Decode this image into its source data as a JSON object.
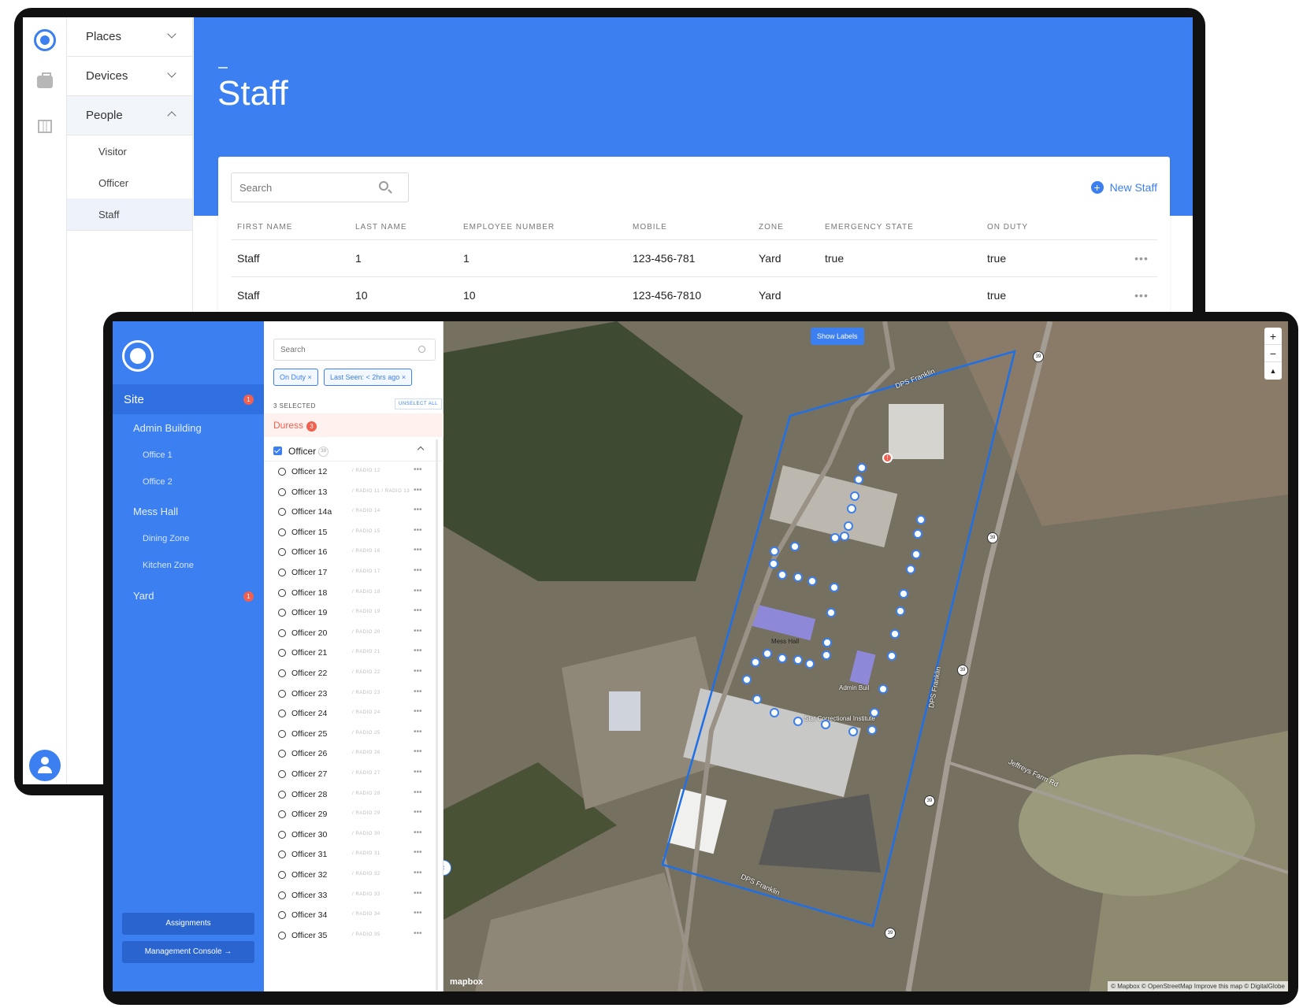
{
  "admin": {
    "nav": [
      {
        "label": "Places",
        "expanded": false
      },
      {
        "label": "Devices",
        "expanded": false
      },
      {
        "label": "People",
        "expanded": true,
        "children": [
          "Visitor",
          "Officer",
          "Staff"
        ],
        "selected": "Staff"
      }
    ],
    "page_title": "Staff",
    "search_placeholder": "Search",
    "new_button": "New Staff",
    "columns": [
      "FIRST NAME",
      "LAST NAME",
      "EMPLOYEE NUMBER",
      "MOBILE",
      "ZONE",
      "EMERGENCY STATE",
      "ON DUTY"
    ],
    "rows": [
      [
        "Staff",
        "1",
        "1",
        "123-456-781",
        "Yard",
        "true",
        "true"
      ],
      [
        "Staff",
        "10",
        "10",
        "123-456-7810",
        "Yard",
        "",
        "true"
      ]
    ],
    "row_menu": "•••"
  },
  "console": {
    "site_label": "Site",
    "site_badge": "1",
    "zones": [
      {
        "label": "Admin Building",
        "level": 1
      },
      {
        "label": "Office 1",
        "level": 2
      },
      {
        "label": "Office 2",
        "level": 2
      },
      {
        "label": "Mess Hall",
        "level": 1
      },
      {
        "label": "Dining Zone",
        "level": 2
      },
      {
        "label": "Kitchen Zone",
        "level": 2
      },
      {
        "label": "Yard",
        "level": 1,
        "badge": "1"
      }
    ],
    "buttons": {
      "assignments": "Assignments",
      "management": "Management Console →"
    },
    "search_placeholder": "Search",
    "filters": [
      "On Duty ×",
      "Last Seen: < 2hrs ago ×"
    ],
    "selected_count": "3 SELECTED",
    "unselect_all": "UNSELECT ALL",
    "duress_label": "Duress",
    "duress_count": "3",
    "group_label": "Officer",
    "group_count": "39",
    "officers": [
      {
        "name": "Officer 12",
        "radio": "/ RADIO 12"
      },
      {
        "name": "Officer 13",
        "radio": "/ RADIO 11 / RADIO 13"
      },
      {
        "name": "Officer 14a",
        "radio": "/ RADIO 14"
      },
      {
        "name": "Officer 15",
        "radio": "/ RADIO 15"
      },
      {
        "name": "Officer 16",
        "radio": "/ RADIO 16"
      },
      {
        "name": "Officer 17",
        "radio": "/ RADIO 17"
      },
      {
        "name": "Officer 18",
        "radio": "/ RADIO 18"
      },
      {
        "name": "Officer 19",
        "radio": "/ RADIO 19"
      },
      {
        "name": "Officer 20",
        "radio": "/ RADIO 20"
      },
      {
        "name": "Officer 21",
        "radio": "/ RADIO 21"
      },
      {
        "name": "Officer 22",
        "radio": "/ RADIO 22"
      },
      {
        "name": "Officer 23",
        "radio": "/ RADIO 23"
      },
      {
        "name": "Officer 24",
        "radio": "/ RADIO 24"
      },
      {
        "name": "Officer 25",
        "radio": "/ RADIO 25"
      },
      {
        "name": "Officer 26",
        "radio": "/ RADIO 26"
      },
      {
        "name": "Officer 27",
        "radio": "/ RADIO 27"
      },
      {
        "name": "Officer 28",
        "radio": "/ RADIO 28"
      },
      {
        "name": "Officer 29",
        "radio": "/ RADIO 29"
      },
      {
        "name": "Officer 30",
        "radio": "/ RADIO 30"
      },
      {
        "name": "Officer 31",
        "radio": "/ RADIO 31"
      },
      {
        "name": "Officer 32",
        "radio": "/ RADIO 32"
      },
      {
        "name": "Officer 33",
        "radio": "/ RADIO 33"
      },
      {
        "name": "Officer 34",
        "radio": "/ RADIO 34"
      },
      {
        "name": "Officer 35",
        "radio": "/ RADIO 35"
      }
    ],
    "item_menu": "•••",
    "map": {
      "show_labels": "Show Labels",
      "zoom_in": "+",
      "zoom_out": "−",
      "compass": "▲",
      "road_labels": [
        "DPS Franklin",
        "DPS Franklin",
        "DPS Franklin",
        "Jeffreys Farm Rd"
      ],
      "route_shield": "39",
      "building_labels": [
        "Mess Hall",
        "Admin Buil",
        "Stat Correctional Institute"
      ],
      "brand": "mapbox",
      "attribution": "© Mapbox © OpenStreetMap Improve this map © DigitalGlobe",
      "collapse": "‹",
      "colors": {
        "boundary": "#1f6fe6",
        "duress_marker": "#f06050",
        "officer_marker": "#3b7ff0"
      }
    }
  }
}
